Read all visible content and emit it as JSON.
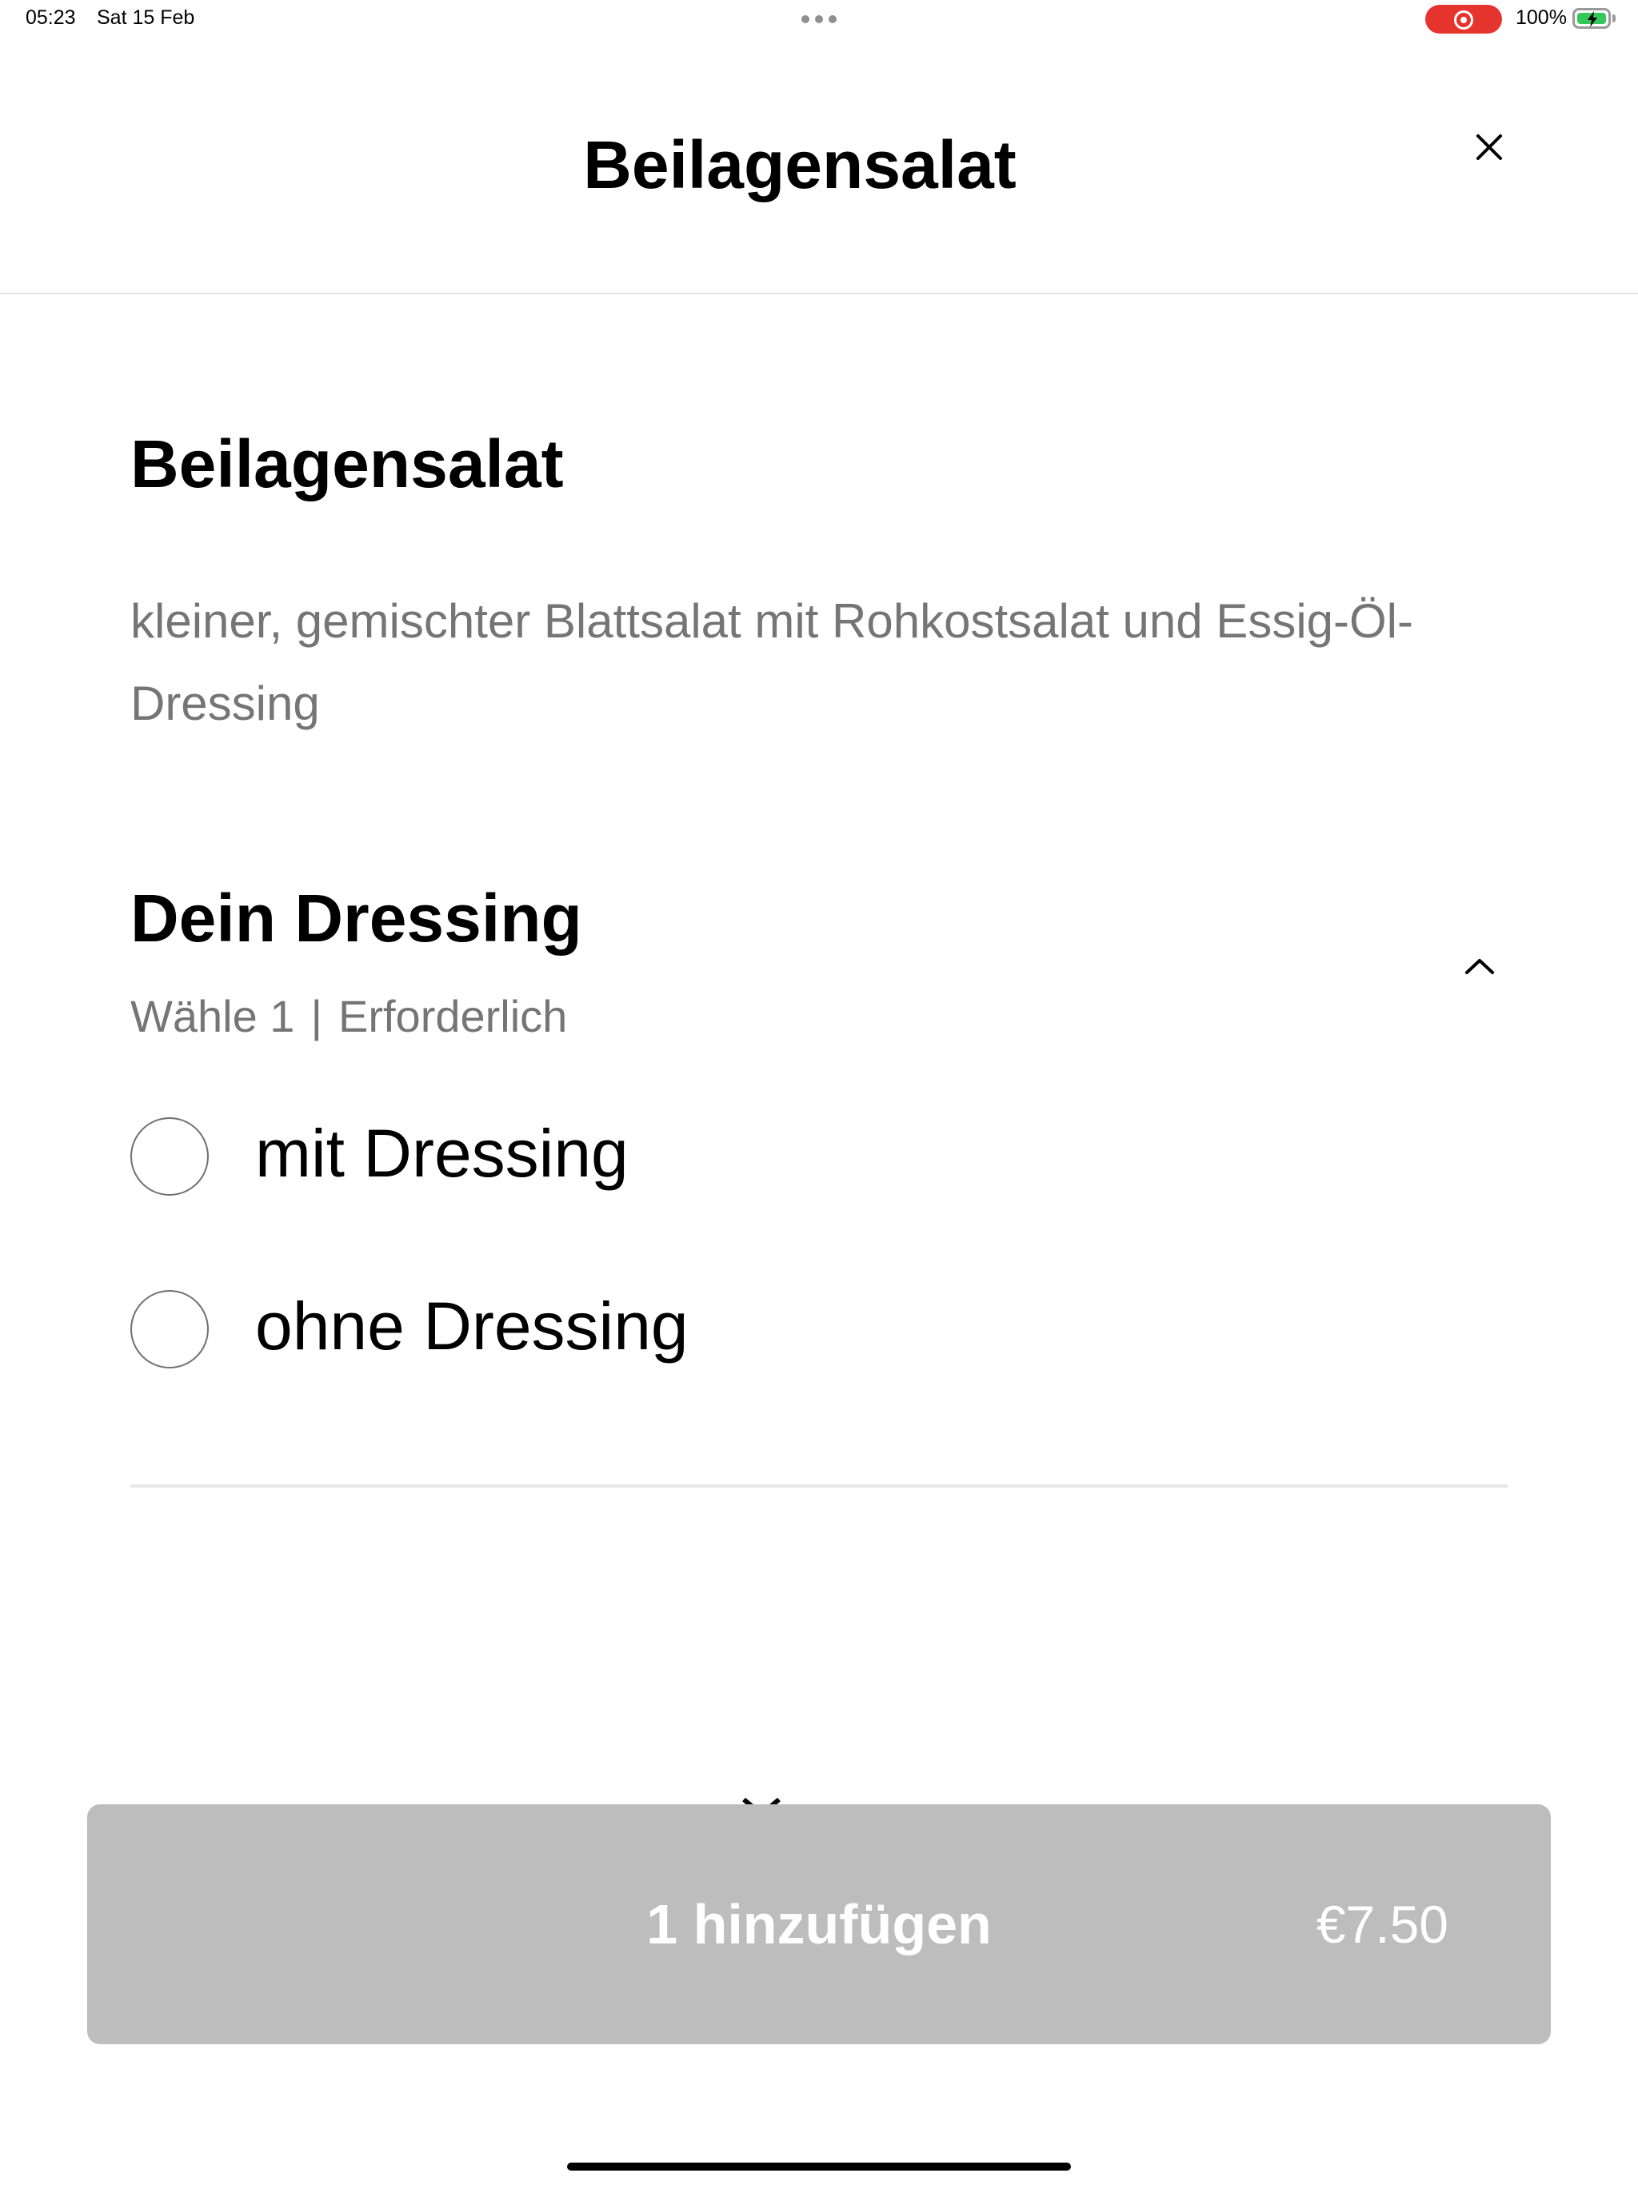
{
  "status_bar": {
    "time": "05:23",
    "date": "Sat 15 Feb",
    "battery_percent": "100%",
    "recording_indicator_color": "#e5342e",
    "battery_color": "#34c759"
  },
  "header": {
    "title": "Beilagensalat",
    "close_icon": "close-icon"
  },
  "item": {
    "title": "Beilagensalat",
    "description": "kleiner, gemischter Blattsalat mit Rohkostsalat und Essig-Öl-Dressing"
  },
  "section": {
    "title": "Dein Dressing",
    "choose": "Wähle 1",
    "separator": "|",
    "required": "Erforderlich",
    "collapse_icon": "chevron-up-icon",
    "options": [
      {
        "label": "mit Dressing",
        "selected": false
      },
      {
        "label": "ohne Dressing",
        "selected": false
      }
    ]
  },
  "add_button": {
    "label": "1 hinzufügen",
    "price": "€7.50",
    "background": "#bdbdbd"
  }
}
